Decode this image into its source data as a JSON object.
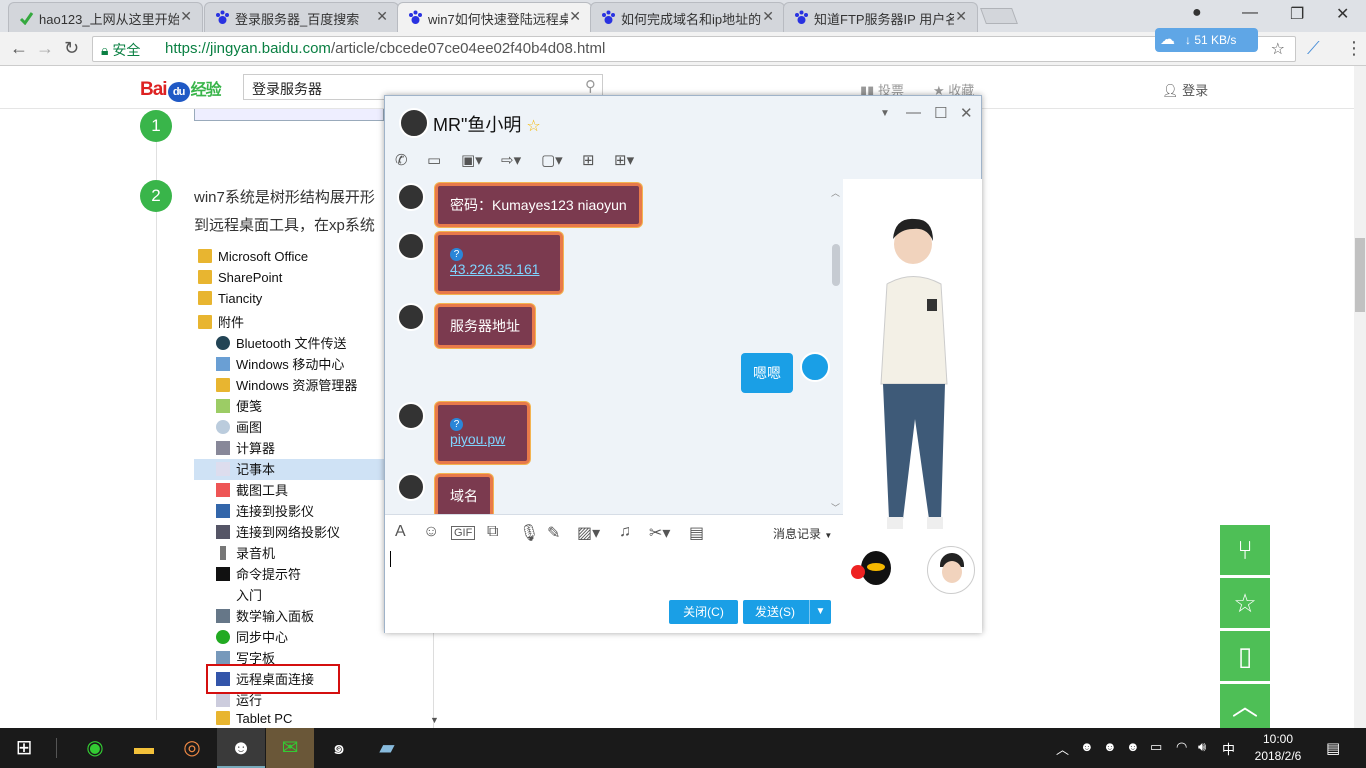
{
  "browser": {
    "tabs": [
      {
        "title": "hao123_上网从这里开始",
        "icon_color": "#35a93f"
      },
      {
        "title": "登录服务器_百度搜索",
        "icon_color": "#2932e1"
      },
      {
        "title": "win7如何快速登陆远程桌",
        "icon_color": "#2932e1",
        "active": true
      },
      {
        "title": "如何完成域名和ip地址的",
        "icon_color": "#2932e1"
      },
      {
        "title": "知道FTP服务器IP 用户名",
        "icon_color": "#2932e1"
      }
    ],
    "secure_label": "安全",
    "url_host": "https://jingyan.baidu.com",
    "url_path": "/article/cbcede07ce04ee02f40b4d08.html",
    "download_speed": "51 KB/s"
  },
  "page": {
    "logo_bai": "Bai",
    "logo_du": "du",
    "logo_suffix": "经验",
    "search_value": "登录服务器",
    "vote_label": "投票",
    "fav_label": "收藏",
    "login_label": "登录",
    "step1_num": "1",
    "step2_num": "2",
    "step2_text_line1": "win7系统是树形结构展开形",
    "step2_text_line2": "到远程桌面工具，在xp系统",
    "start_menu_items": [
      "Microsoft Office",
      "SharePoint",
      "Tiancity",
      "附件",
      "Bluetooth 文件传送",
      "Windows 移动中心",
      "Windows 资源管理器",
      "便笺",
      "画图",
      "计算器",
      "记事本",
      "截图工具",
      "连接到投影仪",
      "连接到网络投影仪",
      "录音机",
      "命令提示符",
      "入门",
      "数学输入面板",
      "同步中心",
      "写字板",
      "远程桌面连接",
      "运行",
      "Tablet PC"
    ]
  },
  "qq": {
    "contact_name": "MR\"鱼小明",
    "messages": [
      {
        "side": "left",
        "text": "密码：Kumayes123 niaoyun",
        "link": false
      },
      {
        "side": "left",
        "text": "43.226.35.161",
        "link": true
      },
      {
        "side": "left",
        "text": "服务器地址",
        "link": false
      },
      {
        "side": "right",
        "text": "嗯嗯",
        "link": false
      },
      {
        "side": "left",
        "text": "piyou.pw",
        "link": true
      },
      {
        "side": "left",
        "text": "域名",
        "link": false
      }
    ],
    "history_label": "消息记录",
    "close_label": "关闭(C)",
    "send_label": "发送(S)"
  },
  "taskbar": {
    "time": "10:00",
    "date": "2018/2/6",
    "ime": "中"
  }
}
